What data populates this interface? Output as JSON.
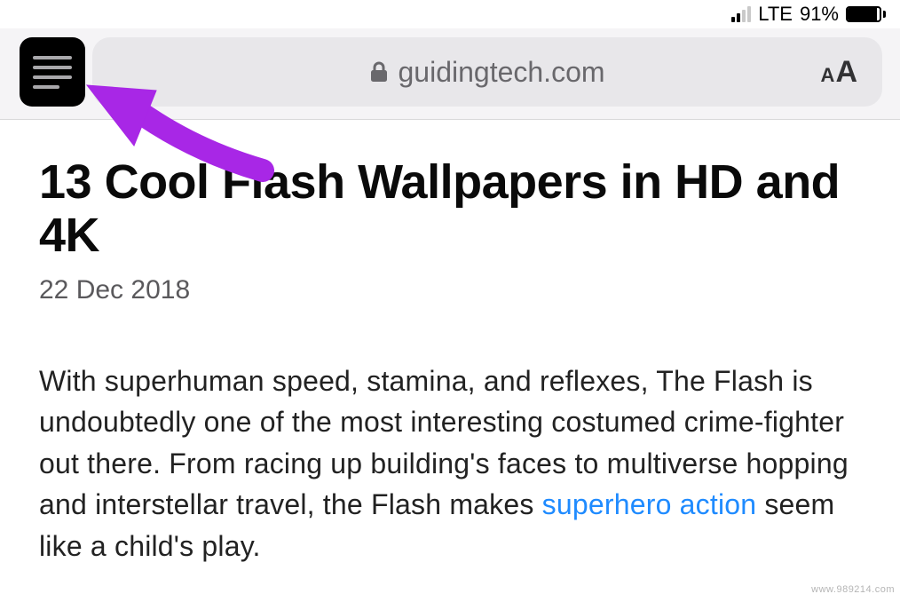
{
  "status": {
    "network": "LTE",
    "battery_pct": "91%",
    "battery_fill_pct": 91,
    "signal_bars_active": 2,
    "signal_bars_total": 4
  },
  "browser": {
    "domain": "guidingtech.com",
    "text_size_small": "A",
    "text_size_large": "A"
  },
  "article": {
    "title": "13 Cool Flash Wallpapers in HD and 4K",
    "date": "22 Dec 2018",
    "body_pre": "With superhuman speed, stamina, and reflexes, The Flash is undoubtedly one of the most interesting costumed crime-fighter out there. From racing up building's faces to multiverse hopping and interstellar travel, the Flash makes ",
    "link_text": "superhero action",
    "body_post": " seem like a child's play."
  },
  "annotation": {
    "arrow_color": "#a827e6"
  },
  "watermark": "www.989214.com"
}
